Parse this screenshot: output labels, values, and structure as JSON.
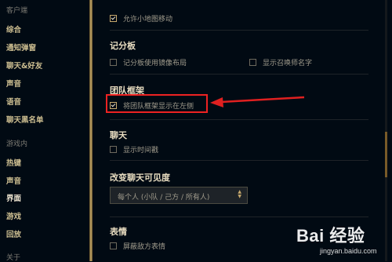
{
  "sidebar": {
    "sections": [
      {
        "title": "客户端",
        "items": [
          "综合",
          "通知弹窗",
          "聊天&好友",
          "声音",
          "语音",
          "聊天黑名单"
        ]
      },
      {
        "title": "游戏内",
        "items": [
          "热键",
          "声音",
          "界面",
          "游戏",
          "回放"
        ]
      },
      {
        "title": "关于",
        "items": []
      }
    ],
    "active_item": "界面"
  },
  "settings": {
    "minimap": {
      "label": "允许小地图移动",
      "checked": true
    },
    "scoreboard": {
      "heading": "记分板",
      "mirror": {
        "label": "记分板使用镜像布局",
        "checked": false
      },
      "summoner": {
        "label": "显示召唤师名字",
        "checked": false
      }
    },
    "team_frame": {
      "heading": "团队框架",
      "left": {
        "label": "将团队框架显示在左侧",
        "checked": true
      }
    },
    "chat": {
      "heading": "聊天",
      "timestamp": {
        "label": "显示时间戳",
        "checked": false
      }
    },
    "chat_visibility": {
      "heading": "改变聊天可见度",
      "selected": "每个人 (小队 / 己方 / 所有人)"
    },
    "emotes": {
      "heading": "表情",
      "mute_enemy": {
        "label": "屏蔽敌方表情",
        "checked": false
      }
    }
  },
  "watermark": {
    "brand": "Bai 经验",
    "url": "jingyan.baidu.com"
  },
  "colors": {
    "accent_gold": "#c8aa6e",
    "annotation_red": "#e02020",
    "background": "#010a13"
  }
}
